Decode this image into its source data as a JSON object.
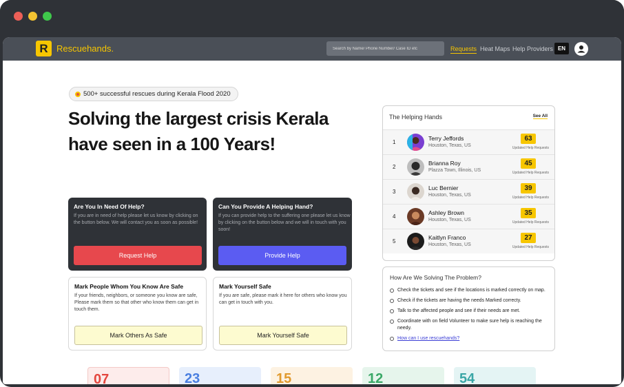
{
  "brand": {
    "name": "Rescuehands.",
    "logo_letter": "R"
  },
  "nav": {
    "search_placeholder": "Search by Name/ Phone Number/ Case ID etc",
    "links": [
      "Requests",
      "Heat Maps",
      "Help Providers"
    ],
    "lang": "EN"
  },
  "hero": {
    "pill": "500+ successful rescues during Kerala Flood 2020",
    "title": "Solving the largest crisis Kerala have seen in a 100 Years!"
  },
  "cards": {
    "need_help": {
      "title": "Are You In Need Of Help?",
      "desc": "If you are in need of help please let us know by clicking on the button below. We will contact you as soon as possible!",
      "button": "Request Help"
    },
    "provide_help": {
      "title": "Can You Provide A Helping Hand?",
      "desc": "If you can provide help to the suffering one please let us know by clicking on the button below and we will in touch with you soon!",
      "button": "Provide Help"
    },
    "mark_others": {
      "title": "Mark People Whom You Know Are Safe",
      "desc": "If your friends, neighbors, or someone you know are safe, Please mark them so that other who know them can get in touch them.",
      "button": "Mark Others As Safe"
    },
    "mark_self": {
      "title": "Mark Yourself Safe",
      "desc": "If you are safe, please mark it here for others who know you can get in touch with you.",
      "button": "Mark Yourself Safe"
    }
  },
  "helping_hands": {
    "title": "The Helping Hands",
    "see_all": "See All",
    "updated_label": "Updated Help Requests",
    "rows": [
      {
        "rank": "1",
        "name": "Terry Jeffords",
        "location": "Houston, Texas, US",
        "count": "63"
      },
      {
        "rank": "2",
        "name": "Brianna Roy",
        "location": "Plazza Town, Illinois, US",
        "count": "45"
      },
      {
        "rank": "3",
        "name": "Luc Bernier",
        "location": "Houston, Texas, US",
        "count": "39"
      },
      {
        "rank": "4",
        "name": "Ashley Brown",
        "location": "Houston, Texas, US",
        "count": "35"
      },
      {
        "rank": "5",
        "name": "Kaitlyn Franco",
        "location": "Houston, Texas, US",
        "count": "27"
      }
    ]
  },
  "solving": {
    "title": "How Are We Solving The Problem?",
    "items": [
      "Check the tickets and see if the locations is marked correctly on map.",
      "Check if the tickets are having the needs Marked correcty.",
      "Talk to the affected people and see if their needs are met.",
      "Coordinate with on field Volunteer to make sure help is reaching the needy."
    ],
    "link": "How can I use rescuehands?"
  },
  "stats": [
    {
      "value": "07",
      "color": "#e4473f"
    },
    {
      "value": "23",
      "color": "#4a7fe0"
    },
    {
      "value": "15",
      "color": "#e19a2e"
    },
    {
      "value": "12",
      "color": "#3aa867"
    },
    {
      "value": "54",
      "color": "#3aa6a6"
    }
  ]
}
